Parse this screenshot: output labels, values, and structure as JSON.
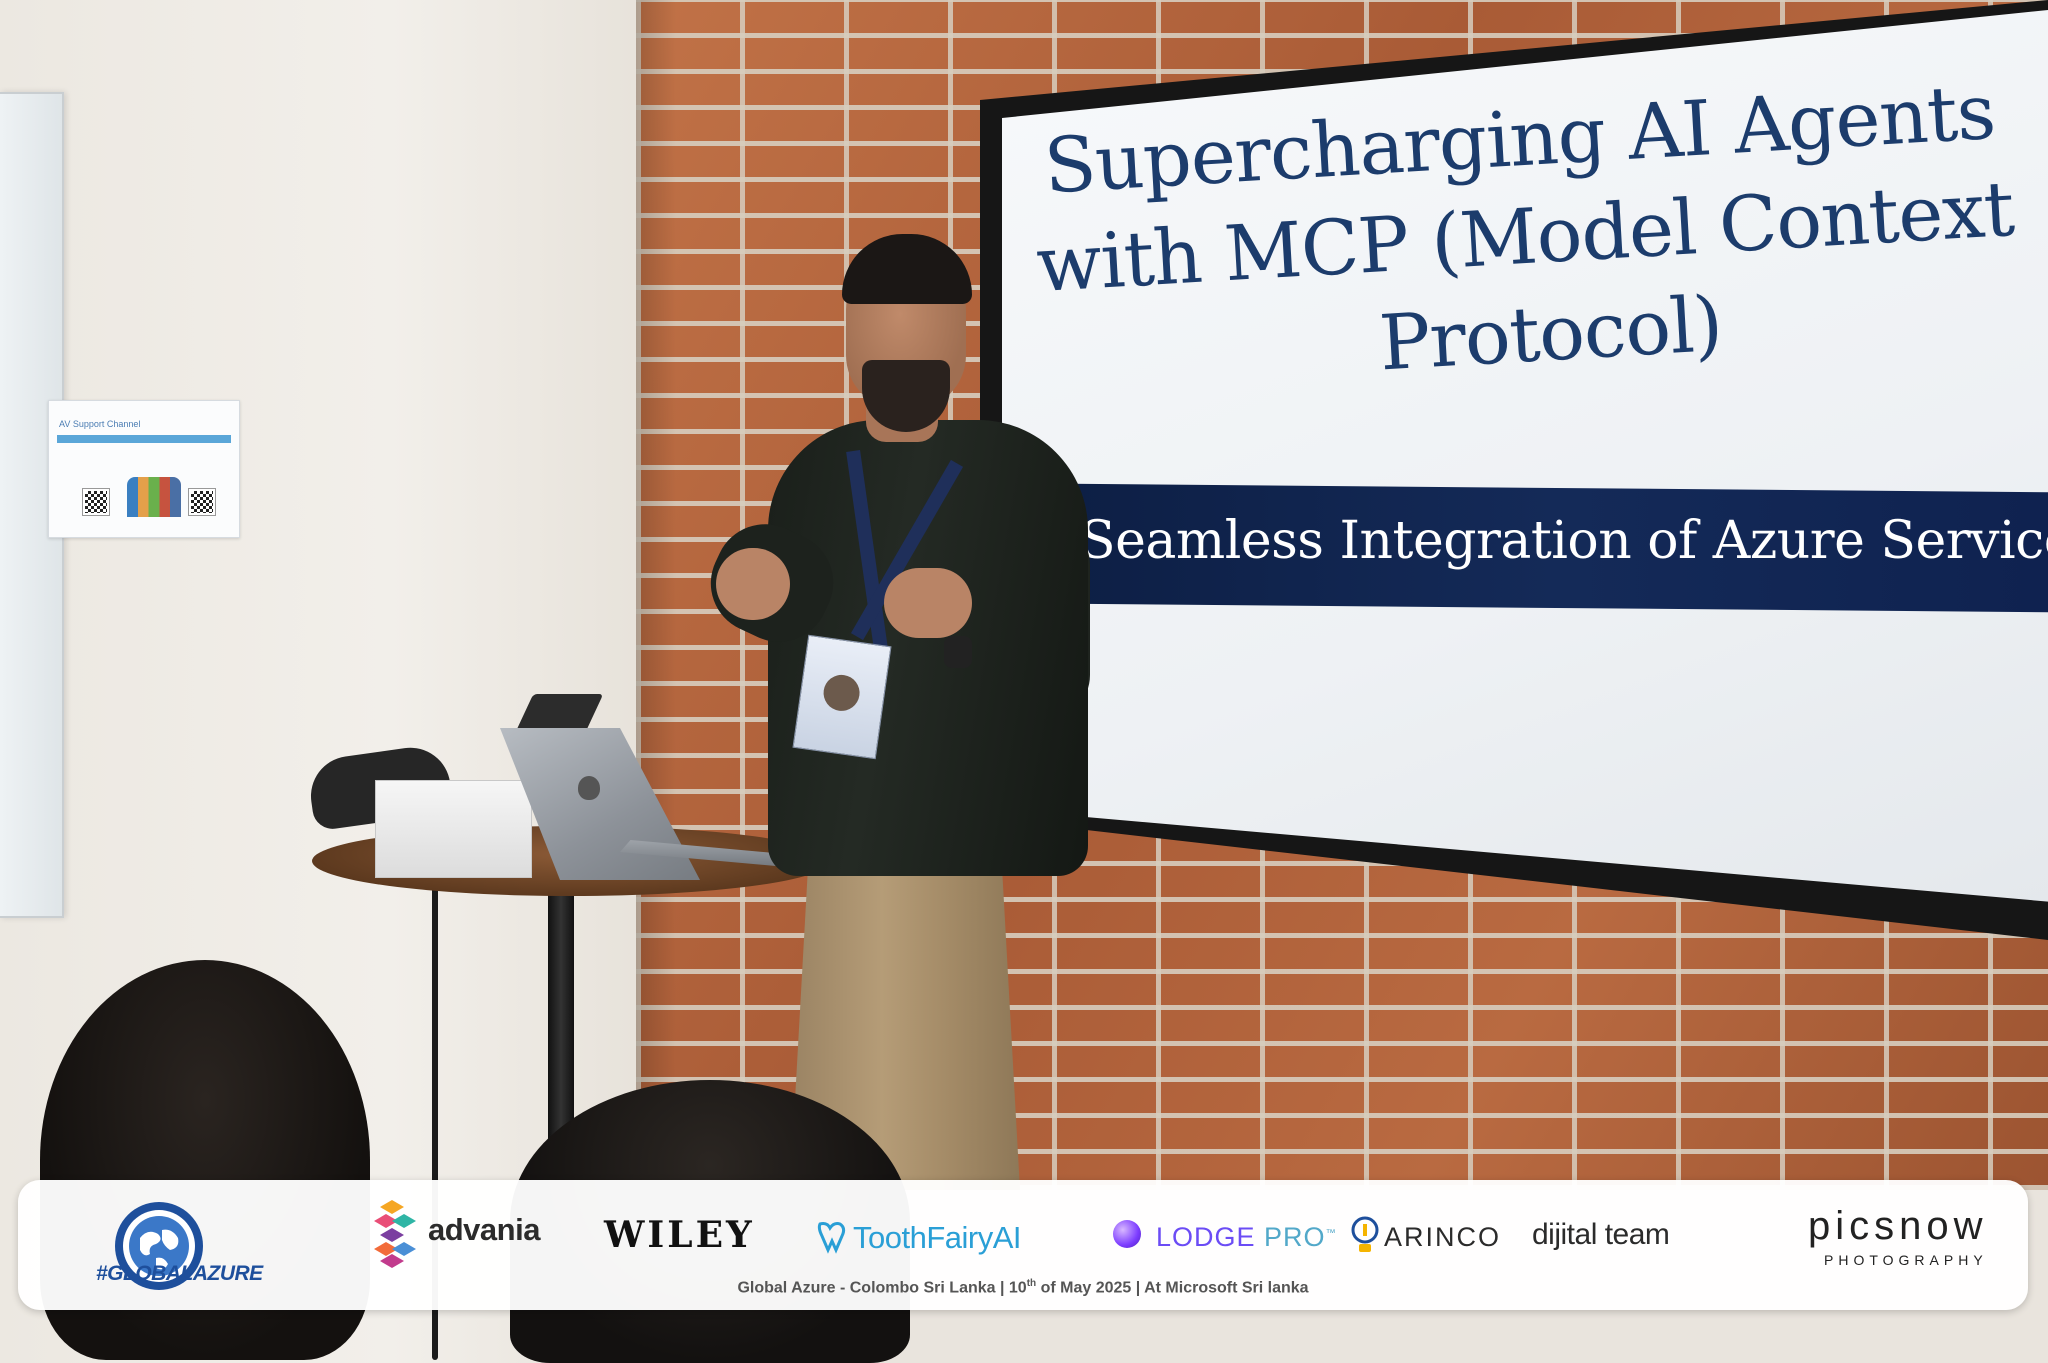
{
  "slide": {
    "title_line1": "Supercharging AI Agents",
    "title_line2": "with MCP (Model Context",
    "title_line3": "Protocol)",
    "subtitle": "Seamless Integration of Azure Services"
  },
  "poster": {
    "title": "AV Support Channel"
  },
  "banner": {
    "global_azure_text": "#GLOBALAZURE",
    "sponsors": {
      "advania": "advania",
      "wiley": "WILEY",
      "toothfairy": "ToothFairyAI",
      "lodge": "LODGE",
      "lodge_suffix": "PRO",
      "lodge_tm": "™",
      "arinco": "ARINCO",
      "dijital": "dijital team",
      "picsnow": "picsnow",
      "picsnow_sub": "PHOTOGRAPHY"
    },
    "caption_part1": "Global Azure - Colombo Sri Lanka | 10",
    "caption_sup": "th",
    "caption_part2": " of May 2025 | At Microsoft Sri lanka"
  },
  "colors": {
    "slide_title": "#1c3c6c",
    "slide_band": "#0f2250",
    "brick": "#b8673f",
    "toothfairy": "#2a9fd6",
    "lodge": "#6b4cf5",
    "global_azure": "#1e4f9c"
  }
}
